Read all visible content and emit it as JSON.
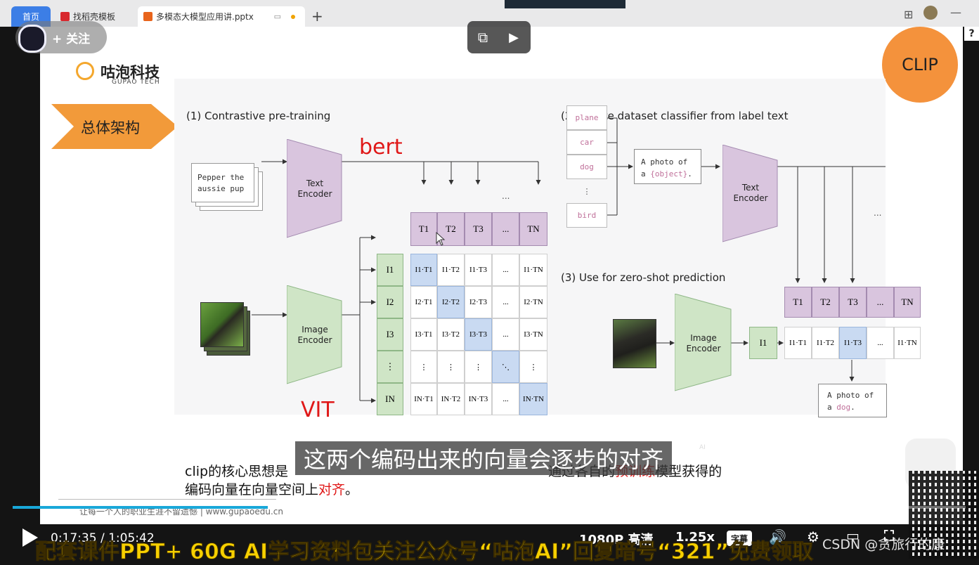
{
  "browser": {
    "tabs": [
      {
        "label": "首页"
      },
      {
        "label": "找稻壳模板"
      },
      {
        "label": "多模态大模型应用讲.pptx"
      }
    ],
    "new_tab": "+",
    "window_min": "—"
  },
  "overlay": {
    "follow_label": "+ 关注"
  },
  "slide": {
    "logo_cn": "咕泡科技",
    "logo_en": "GUPAO TECH",
    "section_title": "总体架构",
    "badge": "CLIP",
    "annot_bert": "bert",
    "annot_vit": "VIT",
    "caption_line1_a": "clip的核心思想是",
    "caption_line1_b": "通过各自的",
    "caption_line1_c": "预训练",
    "caption_line1_d": "模型获得的",
    "caption_line2_a": "编码向量在向量空间上",
    "caption_line2_b": "对齐",
    "caption_line2_c": "。",
    "footer": "让每一个人的职业生涯不留遗憾 | www.gupaoedu.cn",
    "colors": {
      "accent_orange": "#f29a3a",
      "badge": "#f4923c",
      "annot_red": "#e01818"
    }
  },
  "figure": {
    "panel1_title": "(1) Contrastive pre-training",
    "panel2_title": "(2) Create dataset classifier from label text",
    "panel3_title": "(3) Use for zero-shot prediction",
    "input_text_line1": "Pepper the",
    "input_text_line2": "aussie pup",
    "text_encoder_l1": "Text",
    "text_encoder_l2": "Encoder",
    "image_encoder_l1": "Image",
    "image_encoder_l2": "Encoder",
    "t_cells": [
      "T1",
      "T2",
      "T3",
      "...",
      "TN"
    ],
    "i_cells": [
      "I1",
      "I2",
      "I3",
      "⋮",
      "IN"
    ],
    "matrix": [
      [
        "I1·T1",
        "I1·T2",
        "I1·T3",
        "...",
        "I1·TN"
      ],
      [
        "I2·T1",
        "I2·T2",
        "I2·T3",
        "...",
        "I2·TN"
      ],
      [
        "I3·T1",
        "I3·T2",
        "I3·T3",
        "...",
        "I3·TN"
      ],
      [
        "⋮",
        "⋮",
        "⋮",
        "⋱",
        "⋮"
      ],
      [
        "IN·T1",
        "IN·T2",
        "IN·T3",
        "...",
        "IN·TN"
      ]
    ],
    "labels": [
      "plane",
      "car",
      "dog",
      "⋮",
      "bird"
    ],
    "template_l1": "A photo of",
    "template_l2a": "a ",
    "template_l2b": "{object}",
    "template_l2c": ".",
    "zs_row": [
      "I1·T1",
      "I1·T2",
      "I1·T3",
      "...",
      "I1·TN"
    ],
    "zs_i": "I1",
    "result_l1": "A photo of",
    "result_l2a": "a ",
    "result_l2b": "dog",
    "result_l2c": ".",
    "ellipsis": "..."
  },
  "subtitle": "这两个编码出来的向量会逐步的对齐",
  "ai_badge": "AI",
  "player": {
    "time_current": "0:17:35",
    "time_sep": "/",
    "time_total": "1:05:42",
    "progress": 0.268,
    "quality": "1080P 高清",
    "speed": "1.25x",
    "cc": "字幕",
    "watermark": "CSDN @贪旅行的康"
  },
  "banner": "配套课件PPT+ 60G AI学习资料包关注公众号“咕泡AI”回复暗号“321”免费领取"
}
